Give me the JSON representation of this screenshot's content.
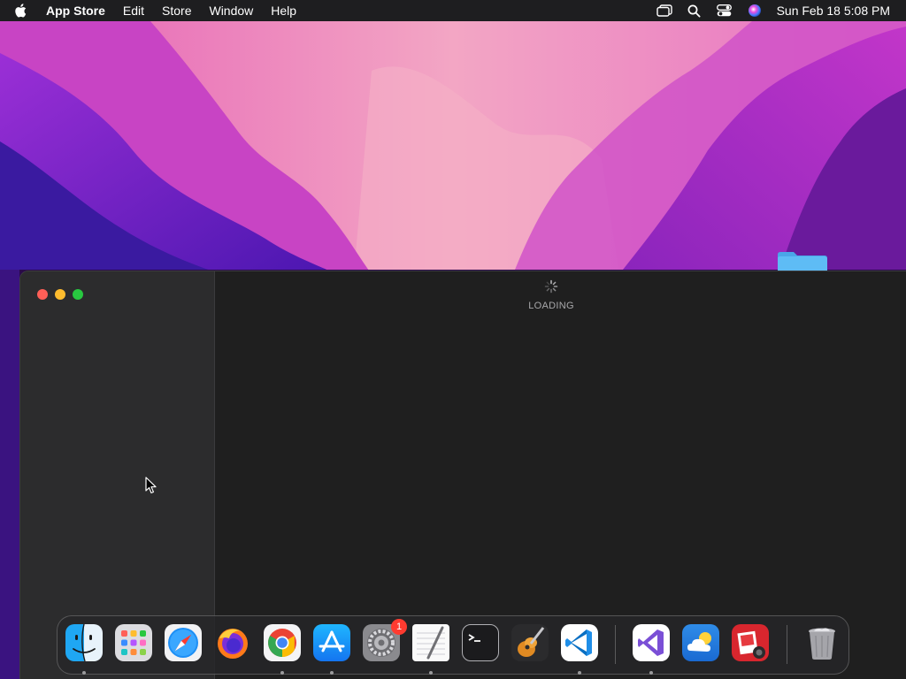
{
  "menubar": {
    "app_name": "App Store",
    "items": [
      "Edit",
      "Store",
      "Window",
      "Help"
    ],
    "status_icons": [
      "screen-mirroring-icon",
      "search-icon",
      "control-center-icon",
      "siri-icon"
    ],
    "clock": "Sun Feb 18  5:08 PM"
  },
  "window": {
    "loading_label": "LOADING"
  },
  "dock": {
    "apps": [
      {
        "name": "finder-icon",
        "running": true
      },
      {
        "name": "launchpad-icon",
        "running": false
      },
      {
        "name": "safari-icon",
        "running": false
      },
      {
        "name": "firefox-icon",
        "running": false
      },
      {
        "name": "chrome-icon",
        "running": true
      },
      {
        "name": "app-store-icon",
        "running": true
      },
      {
        "name": "system-preferences-icon",
        "running": false,
        "badge": "1"
      },
      {
        "name": "textedit-icon",
        "running": true
      },
      {
        "name": "terminal-icon",
        "running": false
      },
      {
        "name": "garageband-icon",
        "running": false
      },
      {
        "name": "vscode-icon",
        "running": true
      },
      {
        "name": "visual-studio-icon",
        "running": true
      },
      {
        "name": "weather-icon",
        "running": false
      },
      {
        "name": "photo-booth-icon",
        "running": false
      },
      {
        "name": "trash-icon",
        "running": false
      }
    ]
  },
  "colors": {
    "menubar_bg": "#1e1e20",
    "window_sidebar": "#2c2c2d",
    "window_content": "#1f1f1f",
    "close": "#fe5f57",
    "minimize": "#febc2e",
    "zoom": "#28c840",
    "badge": "#ff3b30"
  }
}
